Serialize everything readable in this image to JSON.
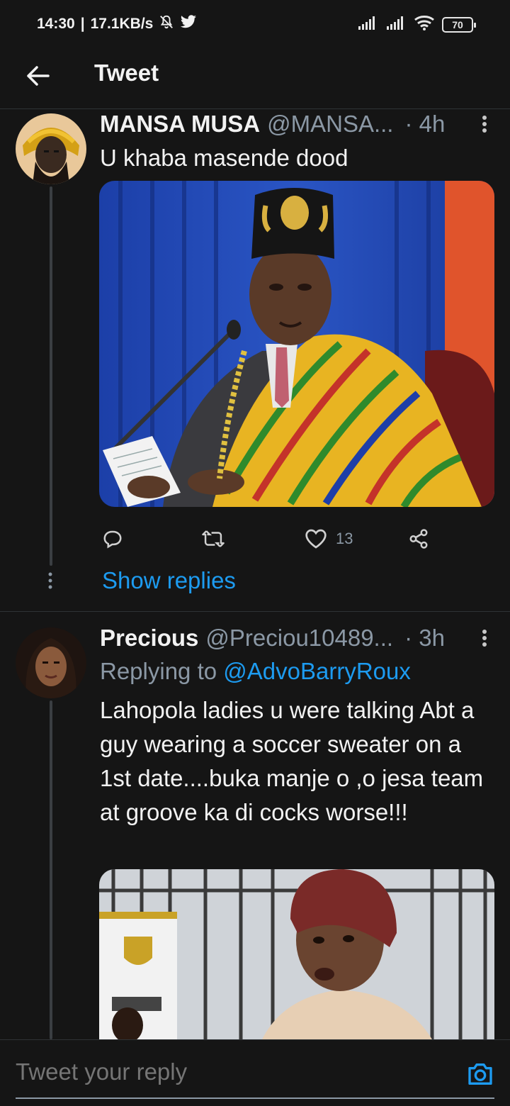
{
  "status_bar": {
    "time": "14:30",
    "speed": "17.1KB/s",
    "battery": "70"
  },
  "header": {
    "title": "Tweet"
  },
  "tweets": [
    {
      "display_name": "MANSA MUSA",
      "handle": "@MANSA...",
      "time": "· 4h",
      "text": "U khaba masende dood",
      "likes": "13",
      "show_replies": "Show replies"
    },
    {
      "display_name": "Precious",
      "handle": "@Preciou10489...",
      "time": "· 3h",
      "replying_prefix": "Replying to",
      "replying_to": "@AdvoBarryRoux",
      "text": "Lahopola ladies u were talking Abt a guy wearing a soccer sweater on a 1st date....buka manje o ,o jesa team at groove ka di cocks worse!!!"
    }
  ],
  "composer": {
    "placeholder": "Tweet your reply"
  },
  "colors": {
    "background": "#151515",
    "accent": "#1d9bf0",
    "secondary_text": "#8b98a5"
  }
}
